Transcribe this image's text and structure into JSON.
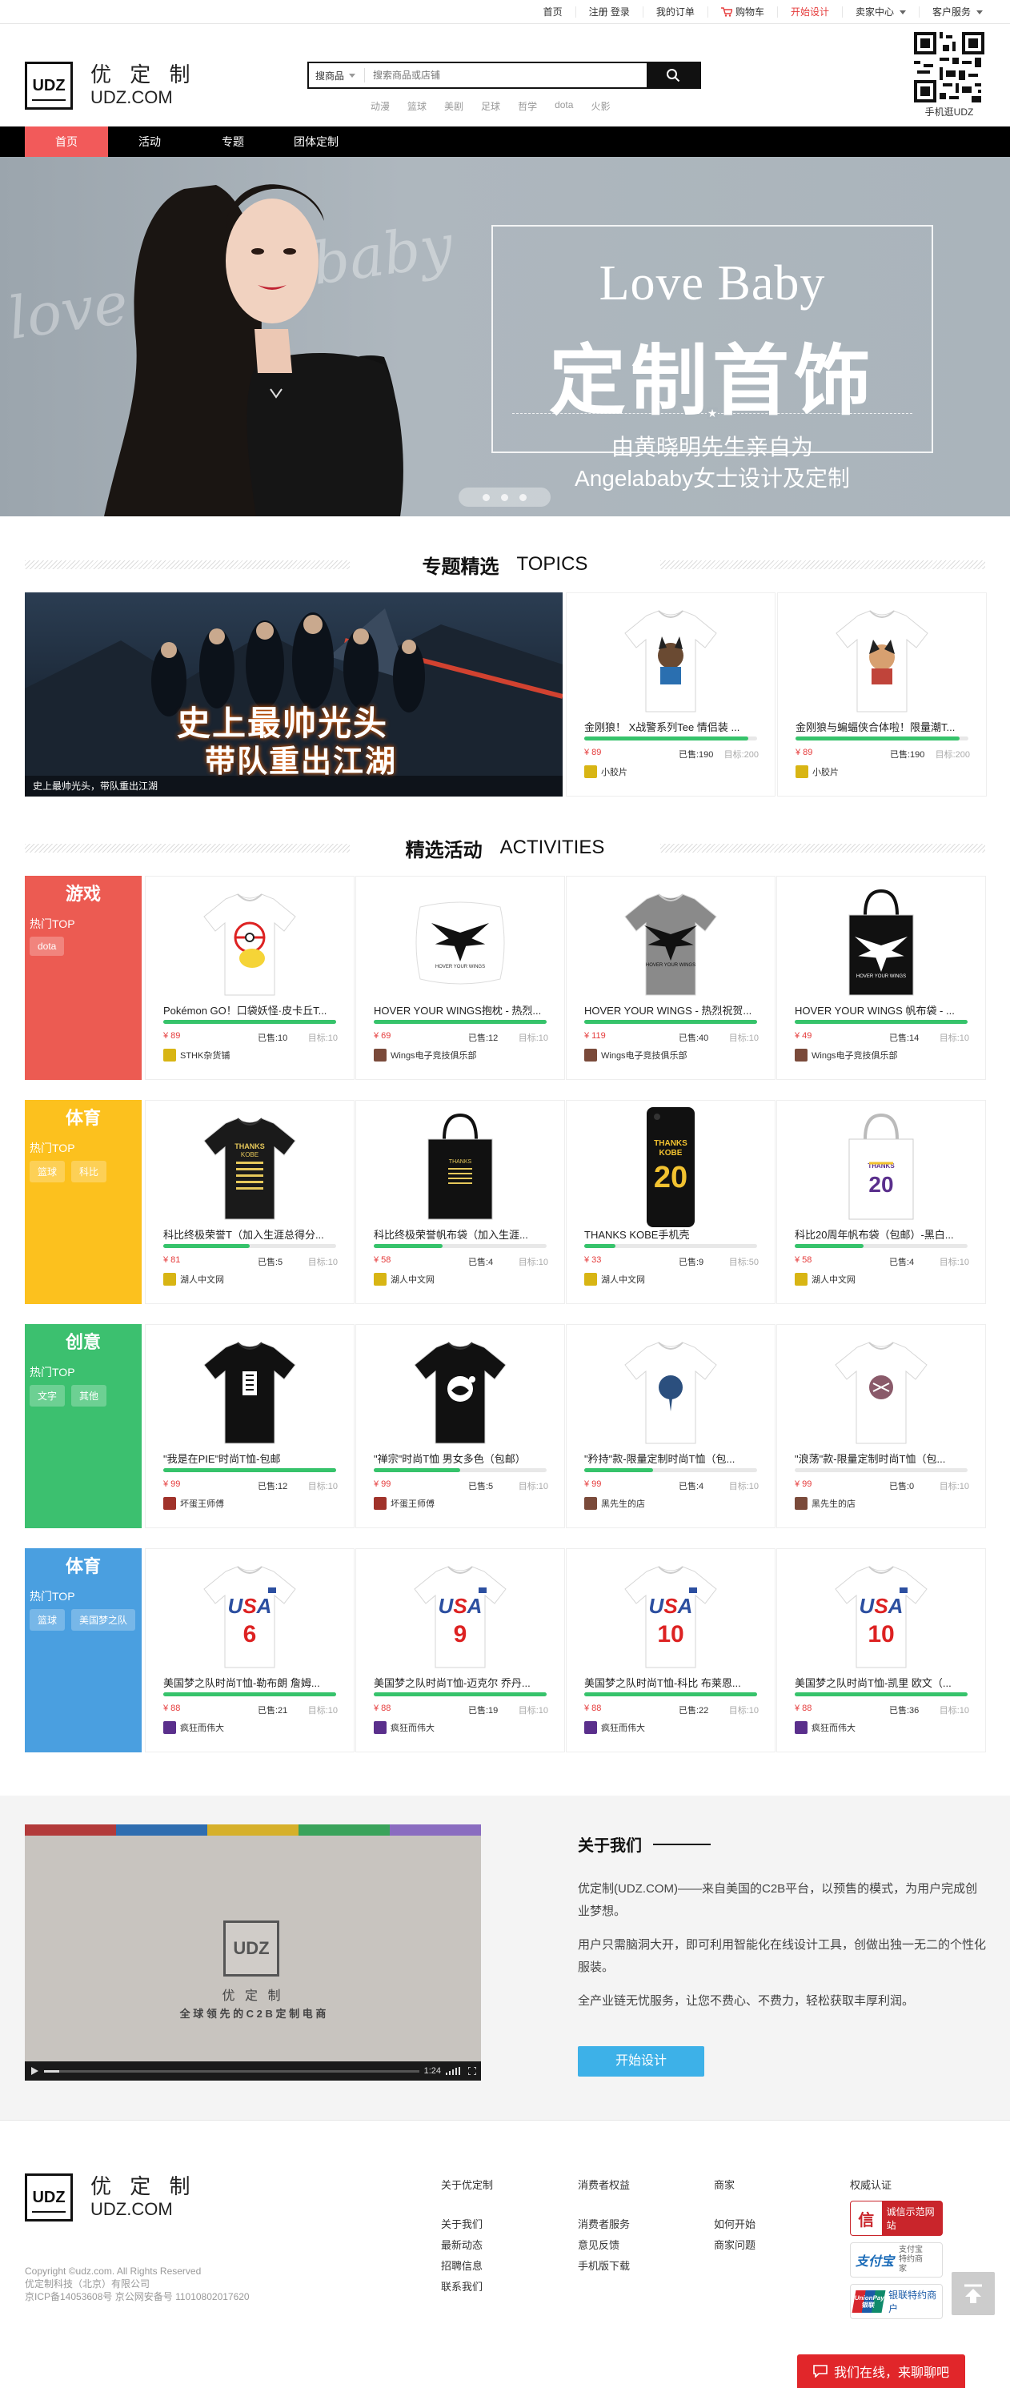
{
  "topbar": {
    "links": [
      "首页",
      "注册 登录",
      "我的订单",
      "购物车",
      "开始设计",
      "卖家中心",
      "客户服务"
    ]
  },
  "header": {
    "logo_mark": "UDZ",
    "logo_cn": "优 定 制",
    "logo_en": "UDZ.COM",
    "search_category": "搜商品",
    "search_placeholder": "搜索商品或店铺",
    "hotwords": [
      "动漫",
      "篮球",
      "美剧",
      "足球",
      "哲学",
      "dota",
      "火影"
    ],
    "qr_label": "手机逛UDZ"
  },
  "nav": {
    "items": [
      "首页",
      "活动",
      "专题",
      "团体定制"
    ]
  },
  "banner": {
    "bg_text_1": "love",
    "bg_text_2": "baby",
    "title_en": "Love Baby",
    "title_cn": "定制首饰",
    "subtitle_1": "由黄晓明先生亲自为",
    "subtitle_2": "Angelababy女士设计及定制"
  },
  "topics": {
    "title_cn": "专题精选",
    "title_en": "TOPICS",
    "feature_text_1": "史上最帅光头",
    "feature_text_2": "带队重出江湖",
    "feature_caption": "史上最帅光头，带队重出江湖",
    "products": [
      {
        "title": "金刚狼！ X战警系列Tee 情侣装 ...",
        "price": "¥ 89",
        "sold": "已售:190",
        "goal": "目标:200",
        "progress": 0.95,
        "shop": "小胶片"
      },
      {
        "title": "金刚狼与蝙蝠侠合体啦！限量潮T...",
        "price": "¥ 89",
        "sold": "已售:190",
        "goal": "目标:200",
        "progress": 0.95,
        "shop": "小胶片"
      }
    ]
  },
  "activities": {
    "title_cn": "精选活动",
    "title_en": "ACTIVITIES",
    "rows": [
      {
        "label": "游戏",
        "color": "#ec5b52",
        "hot": "热门TOP",
        "tags": [
          "dota"
        ],
        "products": [
          {
            "title": "Pokémon GO！口袋妖怪·皮卡丘T...",
            "price": "¥ 89",
            "sold": "已售:10",
            "goal": "目标:10",
            "progress": 1.0,
            "shop": "STHK杂货铺"
          },
          {
            "title": "HOVER YOUR WINGS抱枕 - 热烈...",
            "price": "¥ 69",
            "sold": "已售:12",
            "goal": "目标:10",
            "progress": 1.0,
            "shop": "Wings电子竞技俱乐部"
          },
          {
            "title": "HOVER YOUR WINGS - 热烈祝贺...",
            "price": "¥ 119",
            "sold": "已售:40",
            "goal": "目标:10",
            "progress": 1.0,
            "shop": "Wings电子竞技俱乐部"
          },
          {
            "title": "HOVER YOUR WINGS 帆布袋 - ...",
            "price": "¥ 49",
            "sold": "已售:14",
            "goal": "目标:10",
            "progress": 1.0,
            "shop": "Wings电子竞技俱乐部"
          }
        ]
      },
      {
        "label": "体育",
        "color": "#fcc11e",
        "hot": "热门TOP",
        "tags": [
          "篮球",
          "科比"
        ],
        "products": [
          {
            "title": "科比终极荣誉T（加入生涯总得分...",
            "price": "¥ 81",
            "sold": "已售:5",
            "goal": "目标:10",
            "progress": 0.5,
            "shop": "湖人中文网"
          },
          {
            "title": "科比终极荣誉帆布袋（加入生涯...",
            "price": "¥ 58",
            "sold": "已售:4",
            "goal": "目标:10",
            "progress": 0.4,
            "shop": "湖人中文网"
          },
          {
            "title": "THANKS KOBE手机壳",
            "price": "¥ 33",
            "sold": "已售:9",
            "goal": "目标:50",
            "progress": 0.18,
            "shop": "湖人中文网"
          },
          {
            "title": "科比20周年帆布袋（包邮）-黑白...",
            "price": "¥ 58",
            "sold": "已售:4",
            "goal": "目标:10",
            "progress": 0.4,
            "shop": "湖人中文网"
          }
        ]
      },
      {
        "label": "创意",
        "color": "#3cc06f",
        "hot": "热门TOP",
        "tags": [
          "文字",
          "其他"
        ],
        "products": [
          {
            "title": "\"我是在PIE\"时尚T恤-包邮",
            "price": "¥ 99",
            "sold": "已售:12",
            "goal": "目标:10",
            "progress": 1.0,
            "shop": "坏蛋王师傅"
          },
          {
            "title": "\"禅宗\"时尚T恤 男女多色（包邮）",
            "price": "¥ 99",
            "sold": "已售:5",
            "goal": "目标:10",
            "progress": 0.5,
            "shop": "坏蛋王师傅"
          },
          {
            "title": "\"矜持\"款-限量定制时尚T恤（包...",
            "price": "¥ 99",
            "sold": "已售:4",
            "goal": "目标:10",
            "progress": 0.4,
            "shop": "黑先生的店"
          },
          {
            "title": "\"浪荡\"款-限量定制时尚T恤（包...",
            "price": "¥ 99",
            "sold": "已售:0",
            "goal": "目标:10",
            "progress": 0.0,
            "shop": "黑先生的店"
          }
        ]
      },
      {
        "label": "体育",
        "color": "#4a9fe0",
        "hot": "热门TOP",
        "tags": [
          "篮球",
          "美国梦之队"
        ],
        "products": [
          {
            "title": "美国梦之队时尚T恤-勒布朗 詹姆...",
            "price": "¥ 88",
            "sold": "已售:21",
            "goal": "目标:10",
            "progress": 1.0,
            "shop": "疯狂而伟大",
            "number": "6"
          },
          {
            "title": "美国梦之队时尚T恤-迈克尔 乔丹...",
            "price": "¥ 88",
            "sold": "已售:19",
            "goal": "目标:10",
            "progress": 1.0,
            "shop": "疯狂而伟大",
            "number": "9"
          },
          {
            "title": "美国梦之队时尚T恤-科比 布莱恩...",
            "price": "¥ 88",
            "sold": "已售:22",
            "goal": "目标:10",
            "progress": 1.0,
            "shop": "疯狂而伟大",
            "number": "10"
          },
          {
            "title": "美国梦之队时尚T恤-凯里 欧文（...",
            "price": "¥ 88",
            "sold": "已售:36",
            "goal": "目标:10",
            "progress": 1.0,
            "shop": "疯狂而伟大",
            "number": "10"
          }
        ]
      }
    ]
  },
  "about": {
    "video_logo": "UDZ",
    "video_brand": "优 定 制",
    "video_slogan": "全 球 领 先 的 C 2 B 定 制 电 商",
    "video_time": "1:24",
    "title": "关于我们",
    "p1": "优定制(UDZ.COM)——来自美国的C2B平台，以预售的模式，为用户完成创业梦想。",
    "p2": "用户只需脑洞大开，即可利用智能化在线设计工具，创做出独一无二的个性化服装。",
    "p3": "全产业链无忧服务，让您不费心、不费力，轻松获取丰厚利润。",
    "button": "开始设计"
  },
  "footer": {
    "copyright": "Copyright ©udz.com. All Rights Reserved",
    "company": "优定制科技（北京）有限公司",
    "icp": "京ICP备14053608号 京公网安备号 11010802017620",
    "columns": [
      {
        "title": "关于优定制",
        "links": [
          "关于我们",
          "最新动态",
          "招聘信息",
          "联系我们"
        ]
      },
      {
        "title": "消费者权益",
        "links": [
          "消费者服务",
          "意见反馈",
          "手机版下载"
        ]
      },
      {
        "title": "商家",
        "links": [
          "如何开始",
          "商家问题"
        ]
      }
    ],
    "cert_title": "权威认证",
    "certs": [
      "诚信示范网站",
      "支付宝 特约商家",
      "银联特约商户"
    ],
    "cert_logos": [
      "信",
      "支付宝",
      "UnionPay 银联"
    ],
    "chat": "我们在线，来聊聊吧"
  }
}
